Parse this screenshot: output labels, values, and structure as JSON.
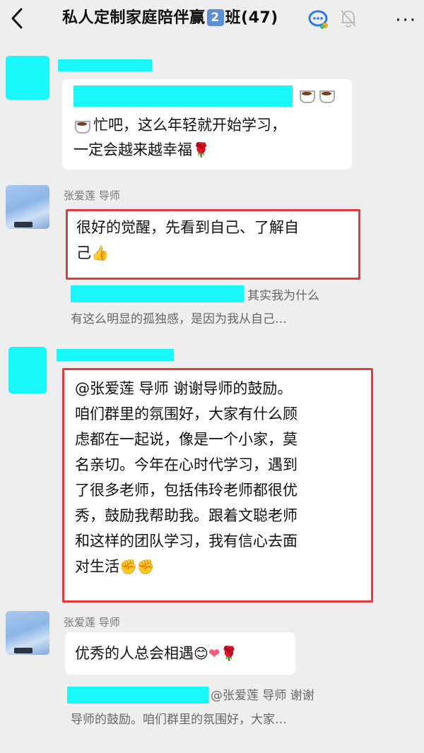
{
  "header": {
    "title_prefix": "私人定制家庭陪伴赢",
    "title_badge": "2",
    "title_suffix": "班(47)",
    "more_label": "···"
  },
  "messages": [
    {
      "sender": "",
      "text_line1": "忙吧，这么年轻就开始学习，",
      "text_line2": "一定会越来越幸福"
    },
    {
      "sender": "张爱莲 导师",
      "text_line1": "很好的觉醒，先看到自己、了解自",
      "text_line2": "己",
      "quote_line1": "其实我为什么",
      "quote_line2": "有这么明显的孤独感，是因为我从自己…"
    },
    {
      "sender": "",
      "lines": [
        "@张爱莲 导师  谢谢导师的鼓励。",
        "咱们群里的氛围好，大家有什么顾",
        "虑都在一起说，像是一个小家，莫",
        "名亲切。今年在心时代学习，遇到",
        "了很多老师，包括伟玲老师都很优",
        "秀，鼓励我帮助我。跟着文聪老师",
        "和这样的团队学习，我有信心去面",
        "对生活"
      ]
    },
    {
      "sender": "张爱莲 导师",
      "text": "优秀的人总会相遇",
      "quote_line1": "@张爱莲 导师 谢谢",
      "quote_line2": "导师的鼓励。咱们群里的氛围好，大家…"
    }
  ],
  "icons": {
    "back": "chevron-left-icon",
    "chat": "chat-bubble-icon",
    "mute": "bell-muted-icon",
    "more": "more-dots-icon"
  },
  "colors": {
    "redaction": "#19f7f8",
    "highlight_box": "#e23b3b",
    "background": "#eeeeee"
  }
}
